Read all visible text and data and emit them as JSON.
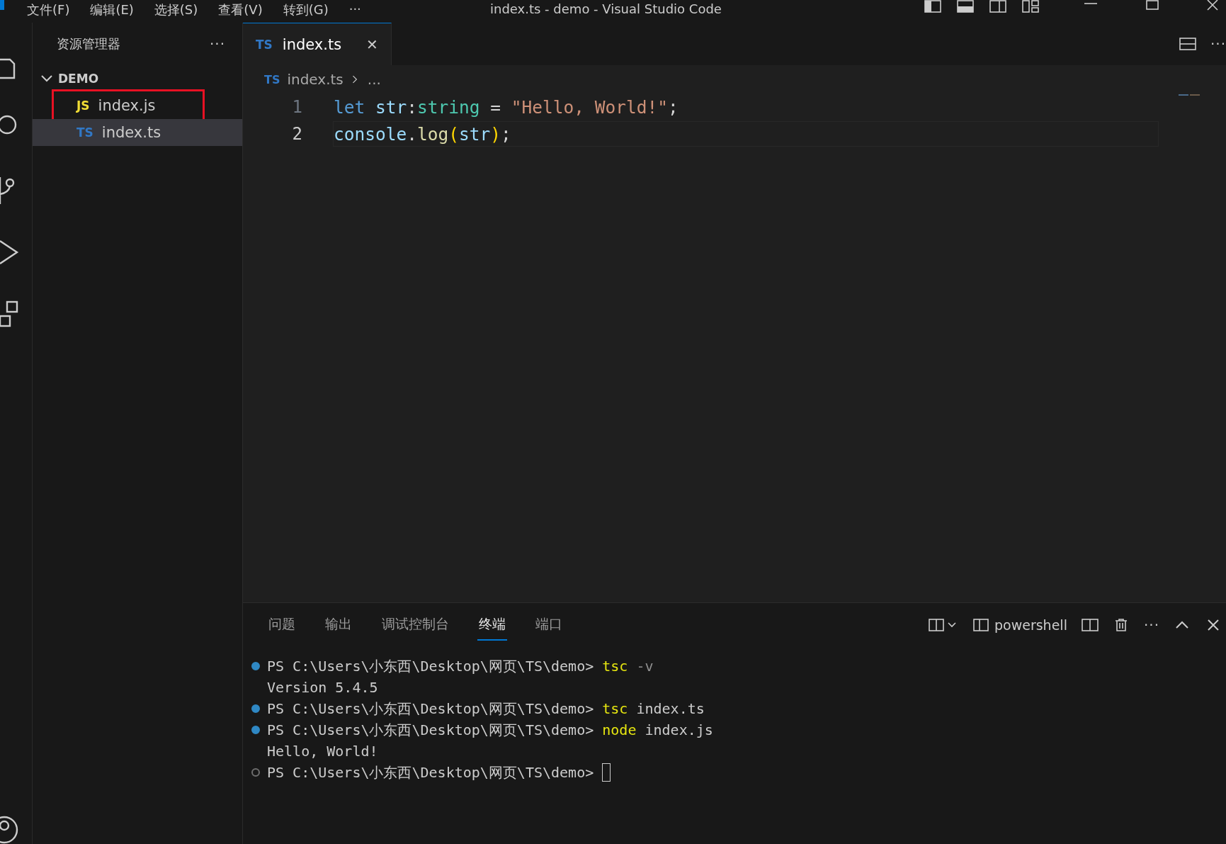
{
  "menu": [
    "文件(F)",
    "编辑(E)",
    "选择(S)",
    "查看(V)",
    "转到(G)",
    "···"
  ],
  "window": {
    "title": "index.ts - demo - Visual Studio Code"
  },
  "sidebar": {
    "title": "资源管理器",
    "more": "···",
    "folder": {
      "name": "DEMO",
      "expanded": true
    },
    "items": [
      {
        "badge": "JS",
        "color": "#f1dd35",
        "name": "index.js",
        "selected": false,
        "annotated": true
      },
      {
        "badge": "TS",
        "color": "#3178c6",
        "name": "index.ts",
        "selected": true,
        "annotated": false
      }
    ]
  },
  "tabs": [
    {
      "badge": "TS",
      "color": "#3178c6",
      "name": "index.ts",
      "selected": true,
      "close": "✕"
    }
  ],
  "tab_more": "···",
  "breadcrumb": {
    "badge": "TS",
    "file": "index.ts",
    "rest": "..."
  },
  "editor": {
    "lines": [
      {
        "number": "1",
        "current": false,
        "tokens": [
          {
            "t": "let",
            "color": "#569cd6"
          },
          {
            "t": " str",
            "color": "#9cdcfe"
          },
          {
            "t": ":",
            "color": "#d4d4d4"
          },
          {
            "t": "string",
            "color": "#4ec9b0"
          },
          {
            "t": " = ",
            "color": "#d4d4d4"
          },
          {
            "t": "\"Hello, World!\"",
            "color": "#ce9178"
          },
          {
            "t": ";",
            "color": "#d4d4d4"
          }
        ]
      },
      {
        "number": "2",
        "current": true,
        "tokens": [
          {
            "t": "console",
            "color": "#9cdcfe"
          },
          {
            "t": ".",
            "color": "#d4d4d4"
          },
          {
            "t": "log",
            "color": "#dcdcaa"
          },
          {
            "t": "(",
            "color": "#ffd700"
          },
          {
            "t": "str",
            "color": "#9cdcfe"
          },
          {
            "t": ")",
            "color": "#ffd700"
          },
          {
            "t": ";",
            "color": "#d4d4d4"
          }
        ]
      }
    ]
  },
  "panel": {
    "tabs": [
      {
        "label": "问题",
        "selected": false
      },
      {
        "label": "输出",
        "selected": false
      },
      {
        "label": "调试控制台",
        "selected": false
      },
      {
        "label": "终端",
        "selected": true
      },
      {
        "label": "端口",
        "selected": false
      }
    ],
    "shell": "powershell",
    "more": "···",
    "terminal": [
      {
        "kind": "command",
        "finished": true,
        "prompt": "PS C:\\Users\\小东西\\Desktop\\网页\\TS\\demo> ",
        "parts": [
          {
            "t": "tsc",
            "color": "#e5e510"
          },
          {
            "t": " -v",
            "color": "#8e8e8e"
          }
        ]
      },
      {
        "kind": "output",
        "text": "Version 5.4.5"
      },
      {
        "kind": "command",
        "finished": true,
        "prompt": "PS C:\\Users\\小东西\\Desktop\\网页\\TS\\demo> ",
        "parts": [
          {
            "t": "tsc",
            "color": "#e5e510"
          },
          {
            "t": " index.ts",
            "color": "#cccccc"
          }
        ]
      },
      {
        "kind": "command",
        "finished": true,
        "prompt": "PS C:\\Users\\小东西\\Desktop\\网页\\TS\\demo> ",
        "parts": [
          {
            "t": "node",
            "color": "#e5e510"
          },
          {
            "t": " index.js",
            "color": "#cccccc"
          }
        ]
      },
      {
        "kind": "output",
        "text": "Hello, World!"
      },
      {
        "kind": "command",
        "finished": false,
        "prompt": "PS C:\\Users\\小东西\\Desktop\\网页\\TS\\demo> ",
        "cursor": true
      }
    ]
  }
}
